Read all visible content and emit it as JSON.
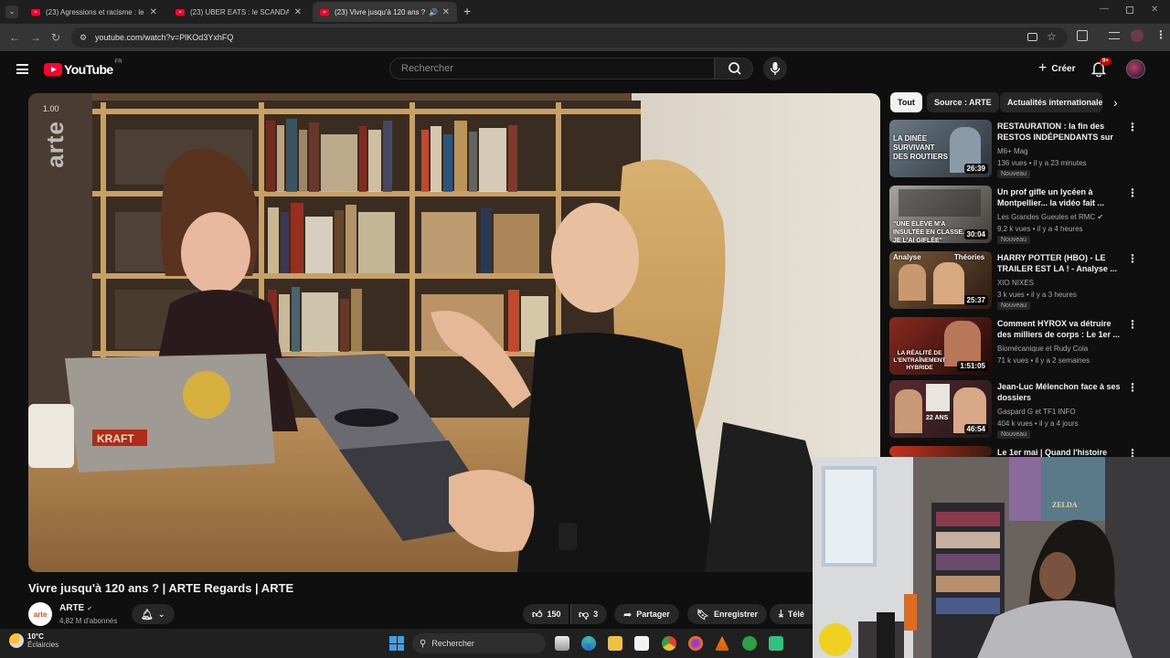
{
  "browser": {
    "tabs": [
      {
        "title": "(23) Agressions et racisme : le",
        "active": false
      },
      {
        "title": "(23) UBER EATS : le SCANDALE",
        "active": false
      },
      {
        "title": "(23) Vivre jusqu'à 120 ans ?",
        "active": true
      }
    ],
    "url": "youtube.com/watch?v=PlKOd3YxhFQ"
  },
  "youtube": {
    "logo_text": "YouTube",
    "region": "FR",
    "search_placeholder": "Rechercher",
    "create_label": "Créer",
    "notif_count": "9+"
  },
  "player": {
    "overlay_speed": "1.00",
    "watermark": "arte"
  },
  "video": {
    "title": "Vivre jusqu'à 120 ans ? | ARTE Regards | ARTE",
    "channel": "ARTE",
    "subscribers": "4,82 M d'abonnés",
    "likes": "150",
    "dislikes": "3",
    "share_label": "Partager",
    "save_label": "Enregistrer",
    "download_label": "Télé"
  },
  "chips": [
    "Tout",
    "Source : ARTE",
    "Actualités internationale"
  ],
  "recommendations": [
    {
      "title": "RESTAURATION : la fin des RESTOS INDÉPENDANTS sur ...",
      "channel": "M6+ Mag",
      "meta": "136 vues • il y a 23 minutes",
      "badge": "Nouveau",
      "duration": "26:39",
      "thumb_text": "LA DINÉE SURVIVANT DES ROUTIERS",
      "thumb_colors": [
        "#6b7a86",
        "#2c3338"
      ]
    },
    {
      "title": "Un prof gifle un lycéen à Montpellier... la vidéo fait ...",
      "channel": "Les Grandes Gueules et RMC",
      "meta": "9,2 k vues • il y a 4 heures",
      "badge": "Nouveau",
      "duration": "30:04",
      "thumb_text": "\"UNE ÉLÈVE M'A INSULTÉE EN CLASSE... JE L'AI GIFLÉE\"",
      "thumb_colors": [
        "#a8a6a0",
        "#3d3b36"
      ]
    },
    {
      "title": "HARRY POTTER (HBO) - LE TRAILER EST LA ! - Analyse ...",
      "channel": "XIO NIXES",
      "meta": "3 k vues • il y a 3 heures",
      "badge": "Nouveau",
      "duration": "25:37",
      "thumb_text": "Analyse Théories",
      "thumb_colors": [
        "#7a5a3a",
        "#2a1a12"
      ]
    },
    {
      "title": "Comment HYROX va détruire des milliers de corps : Le 1er ...",
      "channel": "Biomécanique et Rudy Coia",
      "meta": "71 k vues • il y a 2 semaines",
      "badge": "",
      "duration": "1:51:05",
      "thumb_text": "LA RÉALITÉ DE L'ENTRAÎNEMENT HYBRIDE",
      "thumb_colors": [
        "#8a2a20",
        "#1a0a08"
      ]
    },
    {
      "title": "Jean-Luc Mélenchon face à ses dossiers",
      "channel": "Gaspard G et TF1 INFO",
      "meta": "404 k vues • il y a 4 jours",
      "badge": "Nouveau",
      "duration": "46:54",
      "thumb_text": "22 ANS",
      "thumb_colors": [
        "#5a2a30",
        "#20181a"
      ]
    },
    {
      "title": "Le 1er mai | Quand l'histoire fait",
      "channel": "",
      "meta": "",
      "badge": "",
      "duration": "",
      "thumb_text": "",
      "thumb_colors": [
        "#c83020",
        "#3a1a10"
      ]
    }
  ],
  "taskbar": {
    "temperature": "10°C",
    "weather": "Éclaircies",
    "search_placeholder": "Rechercher"
  }
}
